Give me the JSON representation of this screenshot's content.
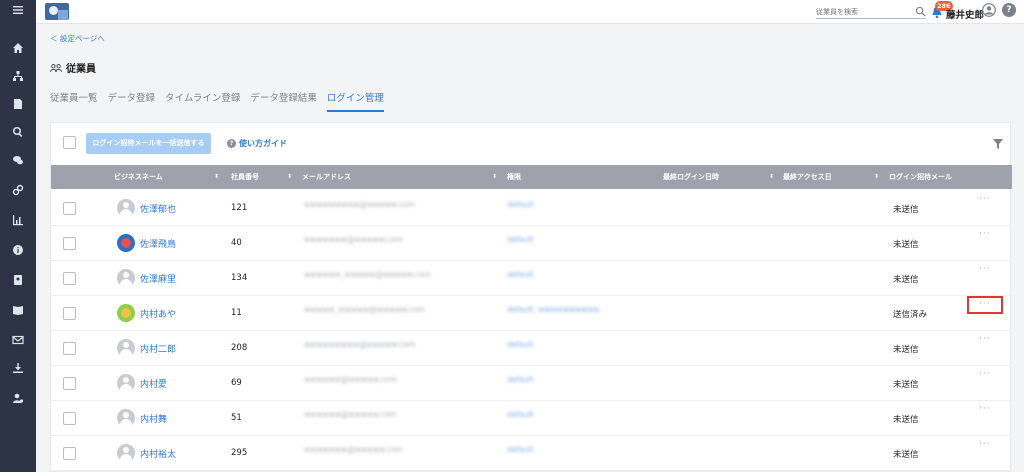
{
  "sidebar": {
    "icons": [
      "menu-icon",
      "home-icon",
      "org-chart-icon",
      "document-icon",
      "search-icon",
      "chat-icon",
      "link-icon",
      "chart-icon",
      "info-icon",
      "id-card-icon",
      "book-icon",
      "mail-icon",
      "download-icon",
      "user-settings-icon"
    ]
  },
  "topbar": {
    "search_placeholder": "従業員を検索",
    "notification_count": "286",
    "user_name": "藤井史郎",
    "help_label": "?"
  },
  "page": {
    "back_link": "＜ 設定ページへ",
    "title": "従業員"
  },
  "tabs": [
    {
      "label": "従業員一覧",
      "active": false
    },
    {
      "label": "データ登録",
      "active": false
    },
    {
      "label": "タイムライン登録",
      "active": false
    },
    {
      "label": "データ登録結果",
      "active": false
    },
    {
      "label": "ログイン管理",
      "active": true
    }
  ],
  "toolbar": {
    "bulk_send_label": "ログイン招待メールを一括送信する",
    "guide_label": "使い方ガイド"
  },
  "table": {
    "columns": [
      "ビジネスネーム",
      "社員番号",
      "メールアドレス",
      "権限",
      "最終ログイン日時",
      "最終アクセス日",
      "ログイン招待メール"
    ],
    "rows": [
      {
        "name": "佐澤郁也",
        "empno": "121",
        "email": "wwwwwwwww@wwwww.com",
        "role": "default",
        "status": "未送信"
      },
      {
        "name": "佐澤飛鳥",
        "empno": "40",
        "email": "wwwwwww@wwwww.com",
        "role": "default",
        "status": "未送信"
      },
      {
        "name": "佐澤麻里",
        "empno": "134",
        "email": "wwwwww_wwwww@wwwww.com",
        "role": "default",
        "status": "未送信"
      },
      {
        "name": "内村あや",
        "empno": "11",
        "email": "wwwww_wwwww@wwwww.com",
        "role": "default, wwwwwwwwww",
        "status": "送信済み"
      },
      {
        "name": "内村二郎",
        "empno": "208",
        "email": "wwwwwwwww@wwwww.com",
        "role": "default",
        "status": "未送信"
      },
      {
        "name": "内村愛",
        "empno": "69",
        "email": "wwwwww@wwwww.com",
        "role": "default",
        "status": "未送信"
      },
      {
        "name": "内村舞",
        "empno": "51",
        "email": "wwwwww@wwwww.com",
        "role": "default",
        "status": "未送信"
      },
      {
        "name": "内村裕太",
        "empno": "295",
        "email": "wwwwwww@wwwww.com",
        "role": "default",
        "status": "未送信"
      }
    ],
    "more_label": "···"
  }
}
